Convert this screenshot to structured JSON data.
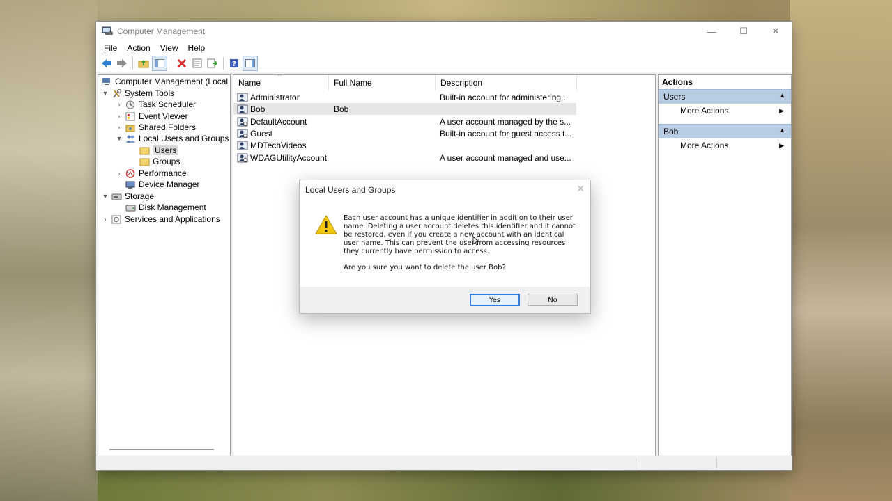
{
  "window": {
    "title": "Computer Management"
  },
  "window_controls": {
    "minimize": "—",
    "maximize": "☐",
    "close": "✕"
  },
  "menu": [
    "File",
    "Action",
    "View",
    "Help"
  ],
  "toolbar_icons": [
    "back-icon",
    "forward-icon",
    "up-folder-icon",
    "show-hide-tree-icon",
    "delete-icon",
    "properties-icon",
    "export-list-icon",
    "help-icon",
    "show-hide-action-pane-icon"
  ],
  "tree": {
    "root": "Computer Management (Local",
    "system_tools": "System Tools",
    "task_scheduler": "Task Scheduler",
    "event_viewer": "Event Viewer",
    "shared_folders": "Shared Folders",
    "local_users_groups": "Local Users and Groups",
    "users": "Users",
    "groups": "Groups",
    "performance": "Performance",
    "device_manager": "Device Manager",
    "storage": "Storage",
    "disk_management": "Disk Management",
    "services_apps": "Services and Applications"
  },
  "list": {
    "columns": [
      "Name",
      "Full Name",
      "Description"
    ],
    "rows": [
      {
        "name": "Administrator",
        "full_name": "",
        "description": "Built-in account for administering..."
      },
      {
        "name": "Bob",
        "full_name": "Bob",
        "description": ""
      },
      {
        "name": "DefaultAccount",
        "full_name": "",
        "description": "A user account managed by the s..."
      },
      {
        "name": "Guest",
        "full_name": "",
        "description": "Built-in account for guest access t..."
      },
      {
        "name": "MDTechVideos",
        "full_name": "",
        "description": ""
      },
      {
        "name": "WDAGUtilityAccount",
        "full_name": "",
        "description": "A user account managed and use..."
      }
    ]
  },
  "actions": {
    "header": "Actions",
    "section1": "Users",
    "section1_item": "More Actions",
    "section2": "Bob",
    "section2_item": "More Actions"
  },
  "dialog": {
    "title": "Local Users and Groups",
    "close": "✕",
    "message": "Each user account has a unique identifier in addition to their user name. Deleting a user account deletes this identifier and it cannot be restored, even if you create a new account with an identical user name. This can prevent the user from accessing resources they currently have permission to access.",
    "question": "Are you sure you want to delete the user Bob?",
    "yes": "Yes",
    "no": "No"
  },
  "colors": {
    "accent": "#3a7bd5",
    "action_section": "#b8cce4",
    "selection": "#e6e6e6",
    "warning": "#f2c811"
  }
}
